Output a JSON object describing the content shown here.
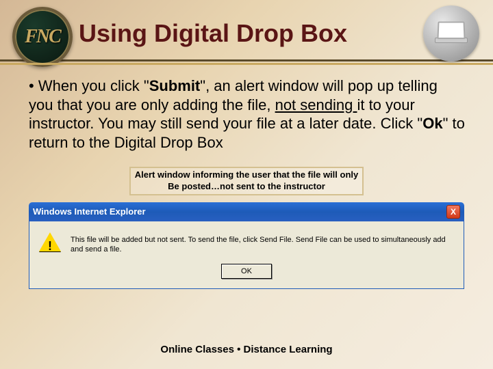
{
  "header": {
    "logo_text": "FNC",
    "title": "Using Digital Drop Box"
  },
  "body": {
    "bullet": "• ",
    "text_1": "When you click \"",
    "submit": "Submit",
    "text_2": "\", an alert window will pop up telling you that you are only adding the file, ",
    "not_sending": "not sending ",
    "text_3": "it to your instructor.  You may still send your file at a later date.  Click \"",
    "ok": "Ok",
    "text_4": "\" to return to the Digital Drop Box"
  },
  "caption": {
    "line1": "Alert window informing the user that the file will only",
    "line2": "Be posted…not sent to the instructor"
  },
  "dialog": {
    "title": "Windows Internet Explorer",
    "close": "X",
    "message": "This file will be added but not sent. To send the file, click Send File. Send File can be used to simultaneously add and send a file.",
    "ok_button": "OK"
  },
  "footer": {
    "text": "Online Classes  •  Distance Learning"
  }
}
